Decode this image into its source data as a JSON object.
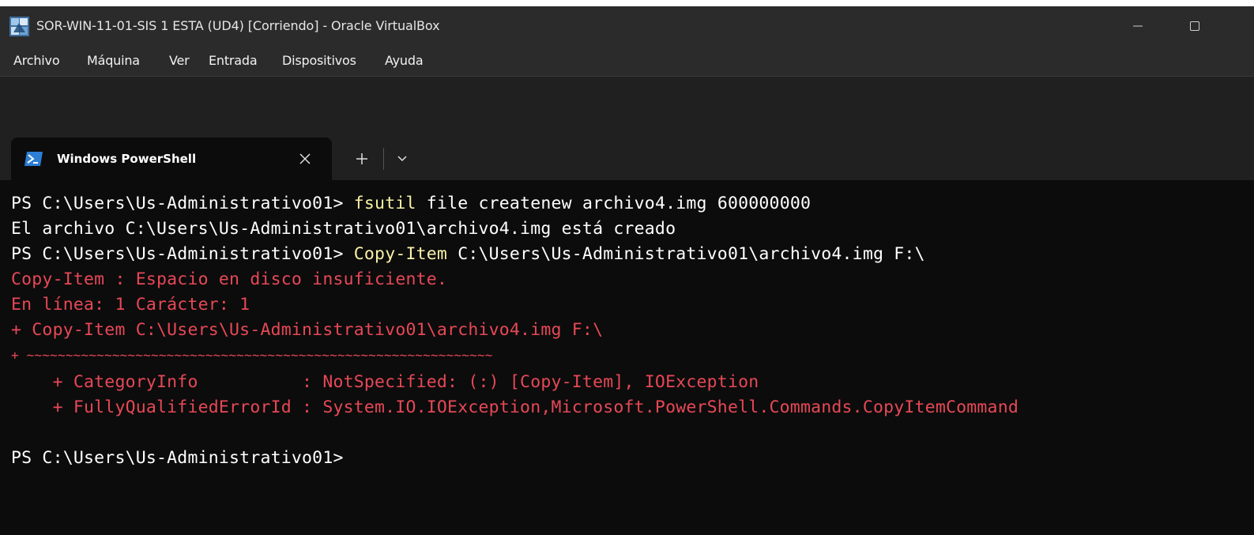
{
  "window": {
    "title": "SOR-WIN-11-01-SIS 1  ESTA (UD4) [Corriendo] - Oracle VirtualBox",
    "icon": "virtualbox-icon",
    "minimize_glyph": "—",
    "maximize_glyph": "☐"
  },
  "menu": {
    "items": [
      "Archivo",
      "Máquina",
      "Ver",
      "Entrada",
      "Dispositivos",
      "Ayuda"
    ]
  },
  "tab": {
    "label": "Windows PowerShell",
    "icon": "powershell-icon",
    "close": "close-icon",
    "new_tab": "plus-icon",
    "dropdown": "chevron-down-icon"
  },
  "terminal": {
    "line1_prompt": "PS C:\\Users\\Us-Administrativo01> ",
    "line1_cmd": "fsutil",
    "line1_args": " file createnew archivo4.img ",
    "line1_num": "600000000",
    "line2": "El archivo C:\\Users\\Us-Administrativo01\\archivo4.img está creado",
    "line3_prompt": "PS C:\\Users\\Us-Administrativo01> ",
    "line3_cmd": "Copy-Item",
    "line3_args": " C:\\Users\\Us-Administrativo01\\archivo4.img F:\\",
    "err1": "Copy-Item : Espacio en disco insuficiente.",
    "err2": "En línea: 1 Carácter: 1",
    "err3": "+ Copy-Item C:\\Users\\Us-Administrativo01\\archivo4.img F:\\",
    "err4": "+ ~~~~~~~~~~~~~~~~~~~~~~~~~~~~~~~~~~~~~~~~~~~~~~~~~~~~~~~~~~~~",
    "err5": "    + CategoryInfo          : NotSpecified: (:) [Copy-Item], IOException",
    "err6": "    + FullyQualifiedErrorId : System.IO.IOException,Microsoft.PowerShell.Commands.CopyItemCommand",
    "line_final": "PS C:\\Users\\Us-Administrativo01>"
  },
  "colors": {
    "error": "#e74856",
    "command": "#f9f1a5",
    "text": "#cccccc",
    "background": "#0c0c0c"
  }
}
